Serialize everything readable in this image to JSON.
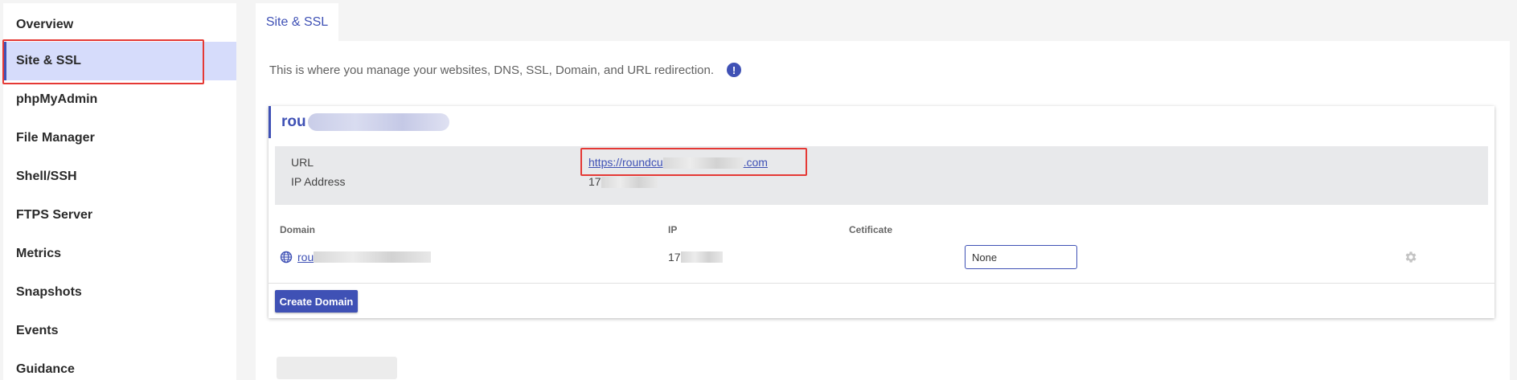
{
  "sidebar": {
    "items": [
      {
        "label": "Overview"
      },
      {
        "label": "Site & SSL",
        "active": true
      },
      {
        "label": "phpMyAdmin"
      },
      {
        "label": "File Manager"
      },
      {
        "label": "Shell/SSH"
      },
      {
        "label": "FTPS Server"
      },
      {
        "label": "Metrics"
      },
      {
        "label": "Snapshots"
      },
      {
        "label": "Events"
      },
      {
        "label": "Guidance"
      }
    ]
  },
  "tab": {
    "label": "Site & SSL"
  },
  "intro": {
    "text": "This is where you manage your websites, DNS, SSL, Domain, and URL redirection.",
    "icon": "info-icon",
    "icon_glyph": "!"
  },
  "site": {
    "name": "rou",
    "url_label": "URL",
    "url_prefix": "https://roundcu",
    "url_suffix": ".com",
    "ip_label": "IP Address",
    "ip_value": "17"
  },
  "table": {
    "headers": {
      "domain": "Domain",
      "ip": "IP",
      "certificate": "Cetificate"
    },
    "rows": [
      {
        "domain": "rou",
        "ip": "17",
        "certificate": "None",
        "domain_icon": "globe-icon",
        "settings_icon": "gear-icon"
      }
    ]
  },
  "actions": {
    "create_domain": "Create Domain"
  },
  "colors": {
    "accent": "#3f51b5",
    "active_bg": "#d6dcfb",
    "highlight": "#e53935"
  }
}
